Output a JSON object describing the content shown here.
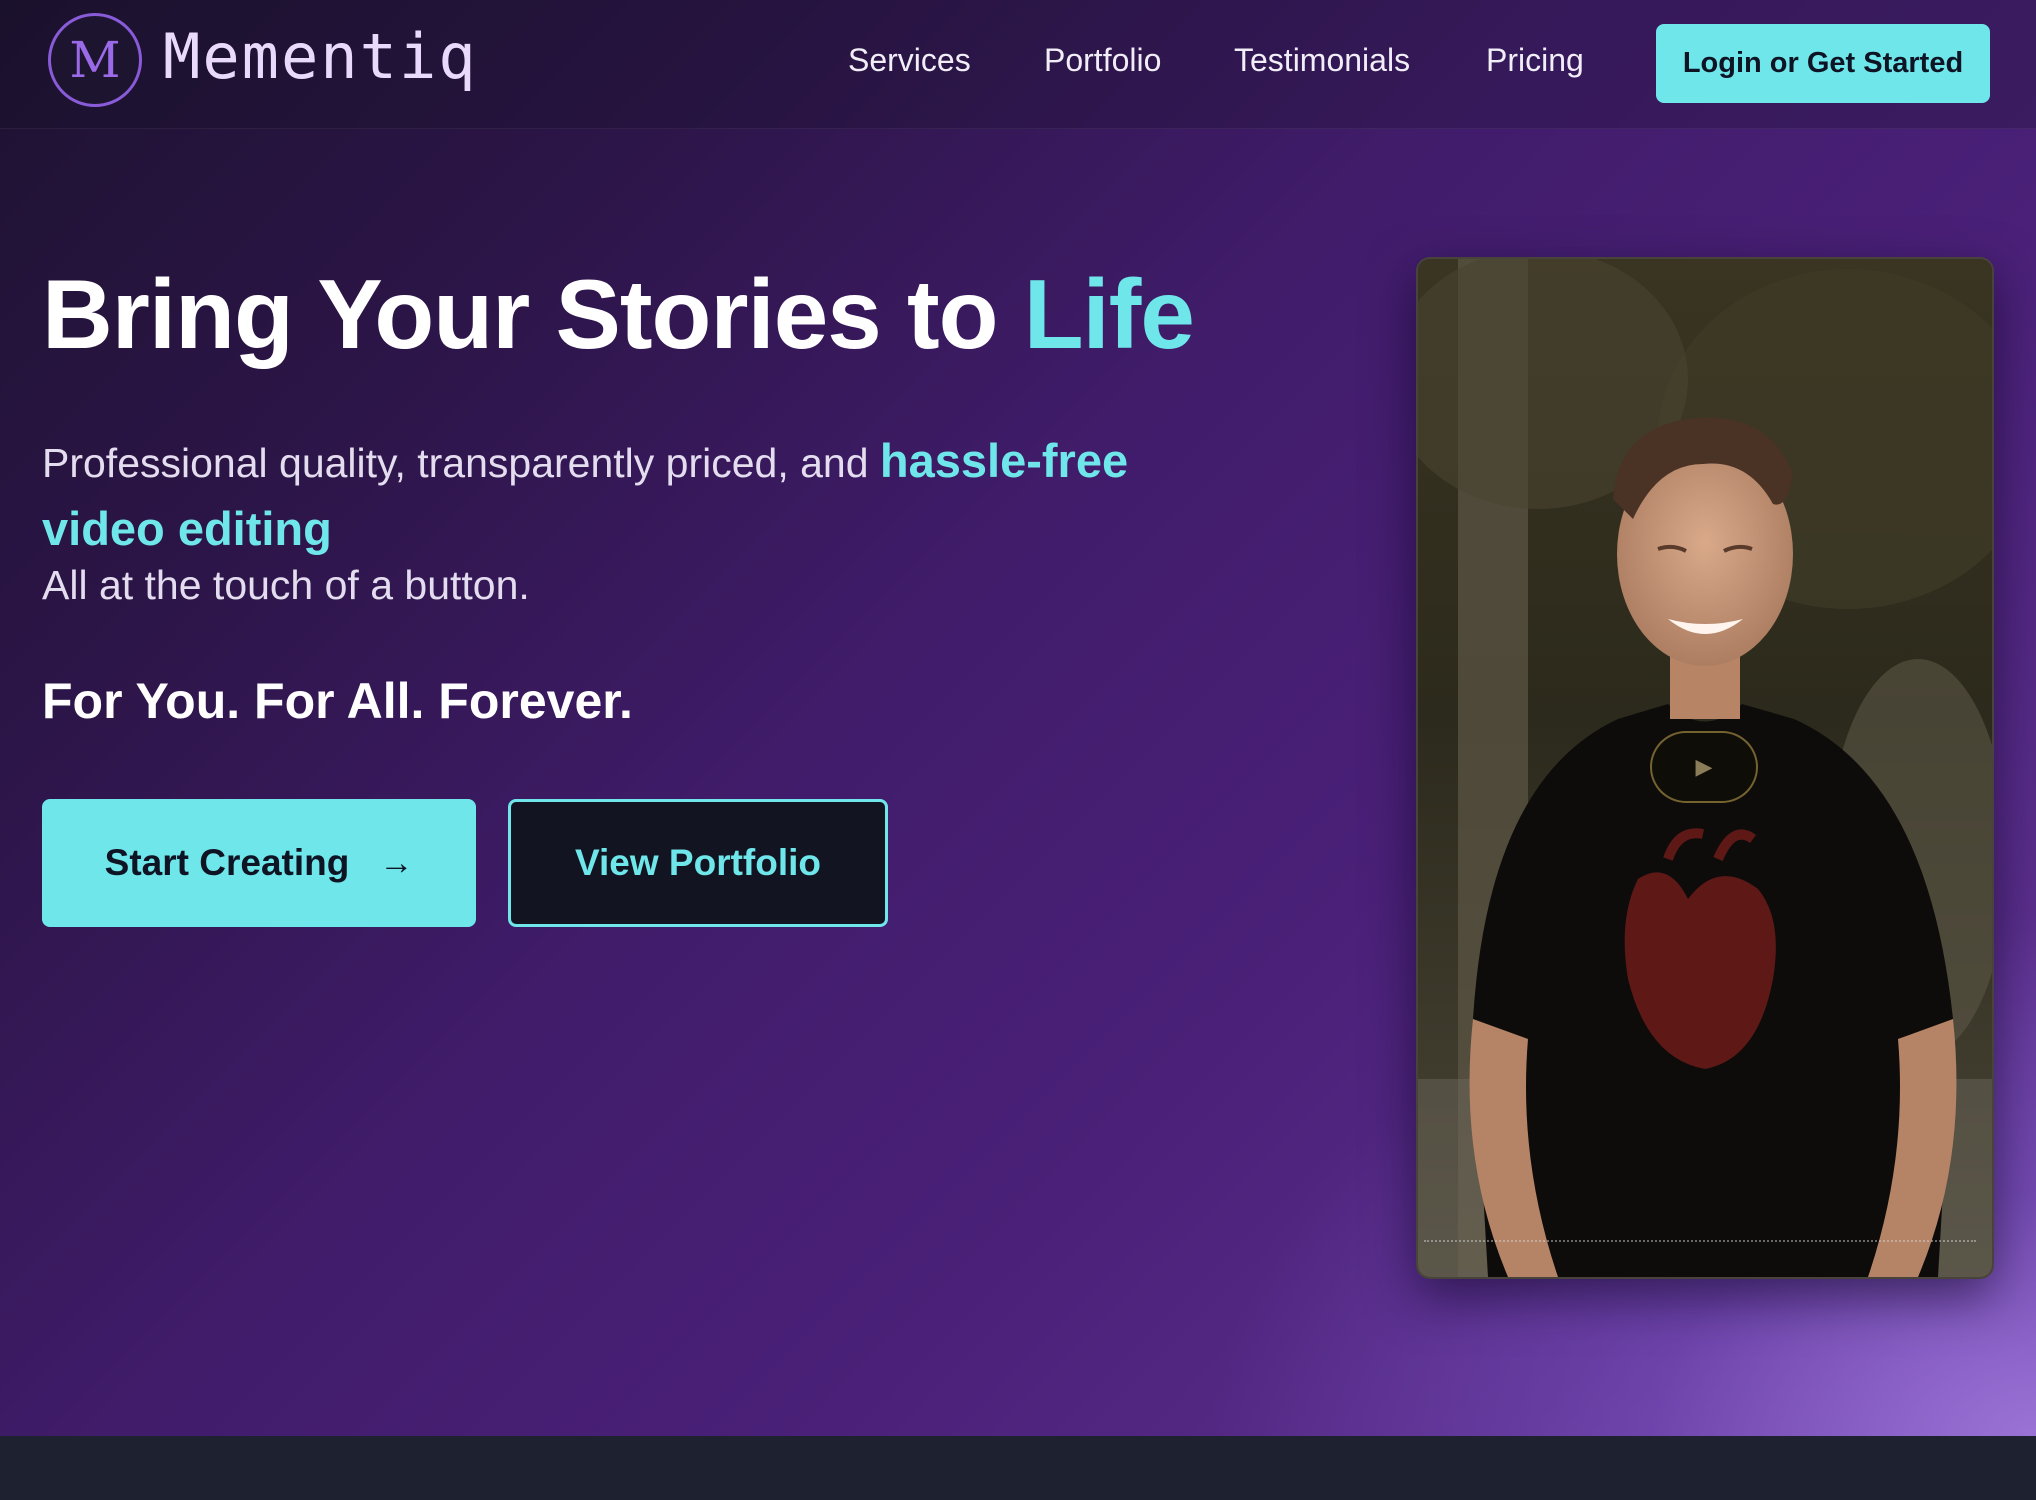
{
  "brand": {
    "logo_letter": "M",
    "name": "Mementiq"
  },
  "nav": {
    "items": [
      {
        "label": "Services"
      },
      {
        "label": "Portfolio"
      },
      {
        "label": "Testimonials"
      },
      {
        "label": "Pricing"
      }
    ],
    "cta_label": "Login or Get Started"
  },
  "hero": {
    "headline_main": "Bring Your Stories to ",
    "headline_accent": "Life",
    "subtitle_plain": "Professional quality, transparently priced, and ",
    "subtitle_highlight": "hassle-free video editing",
    "subline": "All at the touch of a button.",
    "tagline": "For You. For All. Forever.",
    "primary_button": {
      "label": "Start Creating",
      "arrow": "→"
    },
    "secondary_button": {
      "label": "View Portfolio"
    }
  },
  "video": {
    "play_icon": "▶"
  },
  "colors": {
    "accent": "#6ee6ea",
    "brand_purple": "#8a5bd9",
    "footer_band": "#1e2230"
  }
}
